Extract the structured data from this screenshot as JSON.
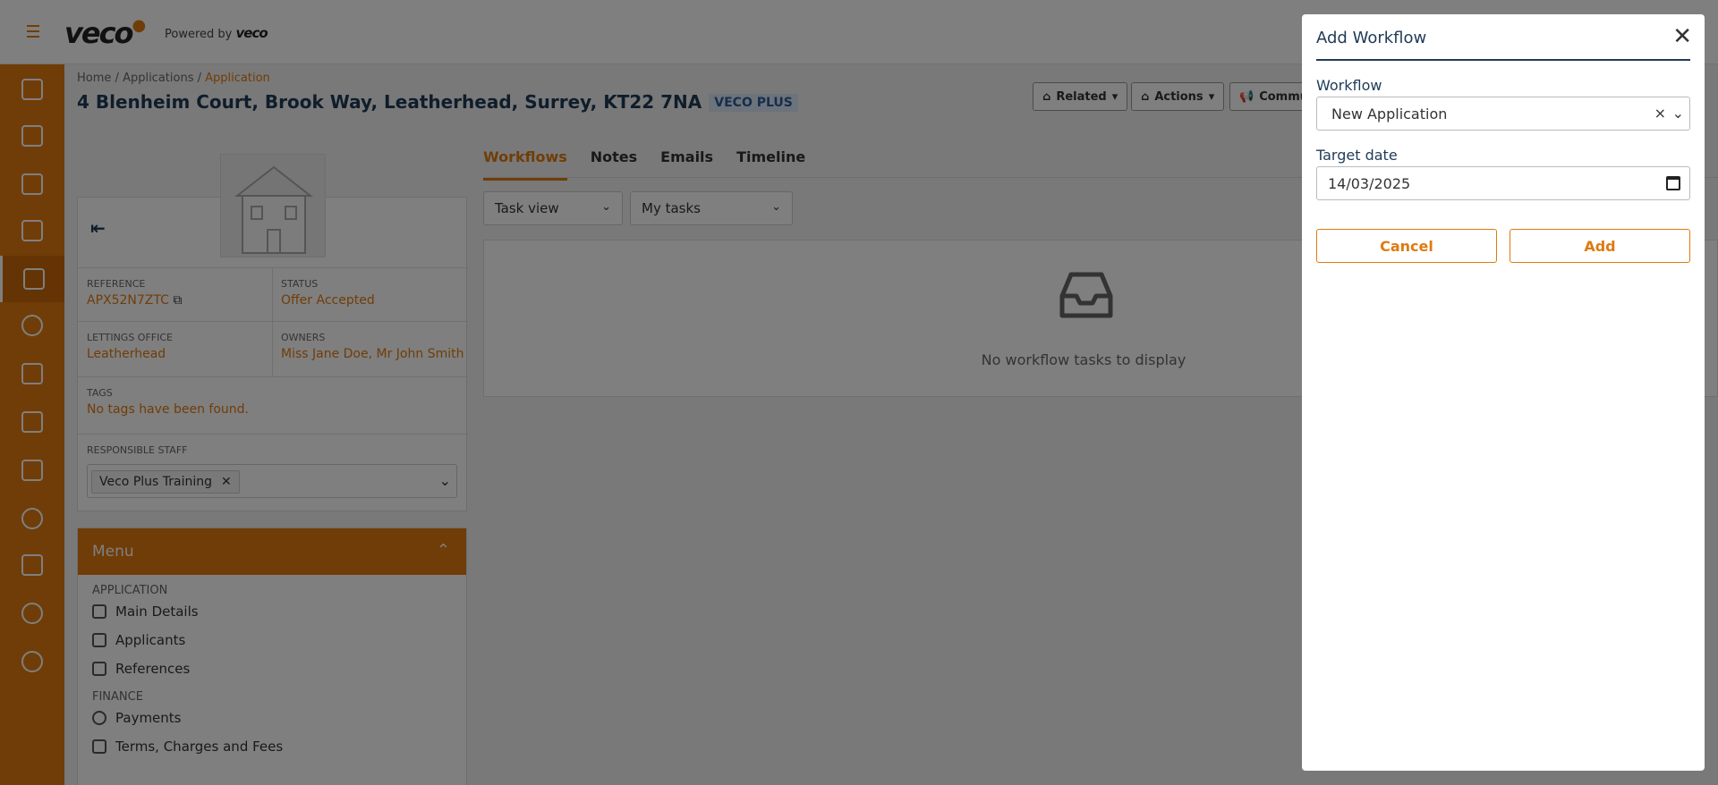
{
  "brand": {
    "logo": "veco",
    "powered_by": "Powered by",
    "powered_by_brand": "veco"
  },
  "breadcrumb": {
    "home": "Home",
    "applications": "Applications",
    "current": "Application",
    "separator": "/"
  },
  "page": {
    "title": "4 Blenheim Court, Brook Way, Leatherhead, Surrey, KT22 7NA",
    "badge": "VECO PLUS"
  },
  "toolbar": {
    "related": "Related",
    "actions": "Actions",
    "communicate": "Commu"
  },
  "info": {
    "reference_label": "REFERENCE",
    "reference_value": "APX52N7ZTC",
    "status_label": "STATUS",
    "status_value": "Offer Accepted",
    "office_label": "LETTINGS OFFICE",
    "office_value": "Leatherhead",
    "owners_label": "OWNERS",
    "owners_value": "Miss Jane Doe, Mr John Smith",
    "tags_label": "TAGS",
    "tags_value": "No tags have been found.",
    "staff_label": "RESPONSIBLE STAFF",
    "staff_tag": "Veco Plus Training"
  },
  "menu": {
    "title": "Menu",
    "section_application": "APPLICATION",
    "main_details": "Main Details",
    "applicants": "Applicants",
    "references": "References",
    "section_finance": "FINANCE",
    "payments": "Payments",
    "terms": "Terms, Charges and Fees"
  },
  "tabs": {
    "workflows": "Workflows",
    "notes": "Notes",
    "emails": "Emails",
    "timeline": "Timeline"
  },
  "filters": {
    "view": "Task view",
    "scope": "My tasks"
  },
  "empty_state": "No workflow tasks to display",
  "modal": {
    "title": "Add Workflow",
    "workflow_label": "Workflow",
    "workflow_value": "New Application",
    "target_date_label": "Target date",
    "target_date_value": "14/03/2025",
    "cancel": "Cancel",
    "add": "Add"
  },
  "colors": {
    "brand": "#e07a10",
    "navy": "#1f3b57"
  }
}
